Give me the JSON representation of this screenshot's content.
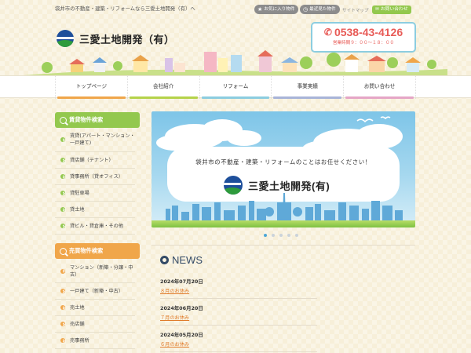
{
  "header": {
    "tagline": "袋井市の不動産・建築・リフォームなら三愛土地開発（有）へ",
    "favorites_label": "お気に入り物件",
    "recent_label": "最近見た物件",
    "sitemap_label": "サイトマップ",
    "contact_label": "お問い合わせ",
    "company_name": "三愛土地開発（有）",
    "phone": "0538-43-4126",
    "hours": "営業時間９：００～１８：００"
  },
  "nav": {
    "items": [
      {
        "label": "トップページ",
        "color": "#f0a64a"
      },
      {
        "label": "会社紹介",
        "color": "#b5d34a"
      },
      {
        "label": "リフォーム",
        "color": "#8ccde0"
      },
      {
        "label": "事業実績",
        "color": "#a8b4d8"
      },
      {
        "label": "お問い合わせ",
        "color": "#e5a6c6"
      }
    ]
  },
  "sidebar": {
    "rental": {
      "title": "賃貸物件検索",
      "color": "#93c84e",
      "items": [
        "賃貸(アパート・マンション・一戸建て)",
        "貸店舗（テナント）",
        "貸事務所（貸オフィス）",
        "貸駐車場",
        "貸土地",
        "貸ビル・貸倉庫・その他"
      ]
    },
    "sale": {
      "title": "売買物件検索",
      "color": "#f0a64a",
      "items": [
        "マンション（新築・分譲・中古）",
        "一戸建て（新築・中古）",
        "売土地",
        "売店舗",
        "売事務所"
      ]
    }
  },
  "hero": {
    "message": "袋井市の不動産・建築・リフォームのことはお任せください！",
    "company_name": "三愛土地開発(有)",
    "slide_count": 5,
    "active_slide": 1
  },
  "news": {
    "title": "NEWS",
    "items": [
      {
        "date": "2024年07月20日",
        "title": "８月のお休み"
      },
      {
        "date": "2024年06月20日",
        "title": "７月のお休み"
      },
      {
        "date": "2024年05月20日",
        "title": "６月のお休み"
      }
    ]
  },
  "colors": {
    "accent_green": "#93c84e",
    "accent_orange": "#f0a64a",
    "phone_red": "#e85b57",
    "news_navy": "#334a66"
  }
}
